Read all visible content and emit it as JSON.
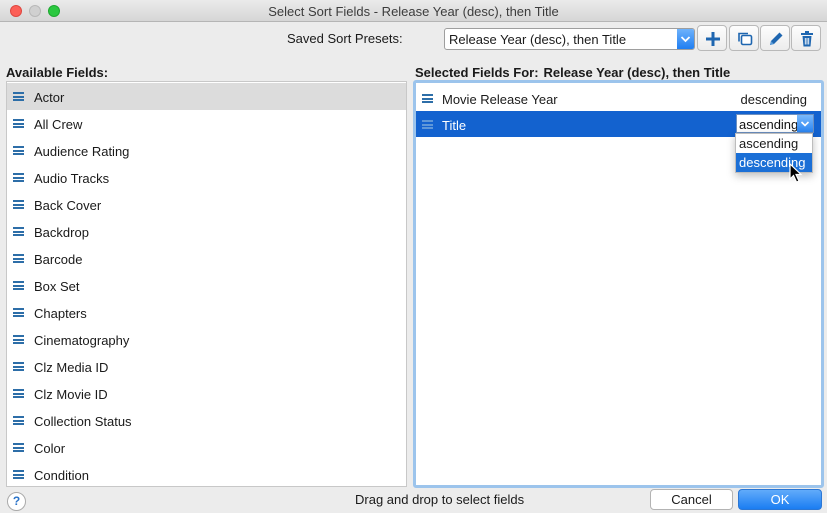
{
  "window": {
    "title": "Select Sort Fields - Release Year (desc), then Title"
  },
  "presets": {
    "label": "Saved Sort Presets:",
    "selected": "Release Year (desc), then Title"
  },
  "toolbar": {
    "add_icon": "plus-icon",
    "duplicate_icon": "duplicate-icon",
    "edit_icon": "pencil-icon",
    "delete_icon": "trash-icon"
  },
  "available": {
    "header": "Available Fields:",
    "items": [
      "Actor",
      "All Crew",
      "Audience Rating",
      "Audio Tracks",
      "Back Cover",
      "Backdrop",
      "Barcode",
      "Box Set",
      "Chapters",
      "Cinematography",
      "Clz Media ID",
      "Clz Movie ID",
      "Collection Status",
      "Color",
      "Condition"
    ]
  },
  "selected": {
    "header_prefix": "Selected Fields For:",
    "header_name": "Release Year (desc), then Title",
    "rows": [
      {
        "field": "Movie Release Year",
        "order": "descending"
      },
      {
        "field": "Title",
        "order": "ascending"
      }
    ]
  },
  "order_dropdown": {
    "options": [
      "ascending",
      "descending"
    ],
    "hovered": "descending"
  },
  "footer": {
    "help": "?",
    "hint": "Drag and drop to select fields",
    "cancel": "Cancel",
    "ok": "OK"
  },
  "colors": {
    "accent": "#1362cf",
    "handle": "#2d6ea8",
    "focus_ring": "#9cc4ec"
  }
}
